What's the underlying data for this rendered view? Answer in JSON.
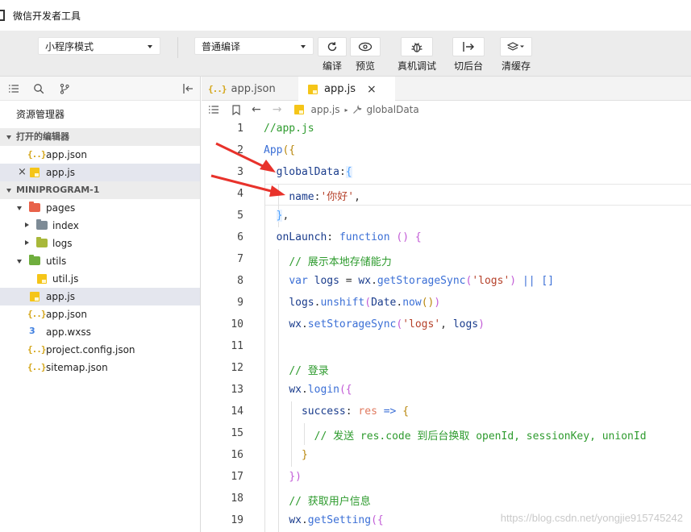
{
  "window": {
    "title": "微信开发者工具"
  },
  "toolbar": {
    "mode_select": "小程序模式",
    "compile_select": "普通编译",
    "buttons": [
      {
        "label": "编译",
        "icon": "refresh-icon"
      },
      {
        "label": "预览",
        "icon": "eye-icon"
      },
      {
        "label": "真机调试",
        "icon": "bug-icon"
      },
      {
        "label": "切后台",
        "icon": "switch-background-icon"
      },
      {
        "label": "清缓存",
        "icon": "layers-icon"
      }
    ]
  },
  "sidebar": {
    "title": "资源管理器",
    "open_editors_header": "打开的编辑器",
    "open_editors": [
      "app.json",
      "app.js"
    ],
    "project_header": "MINIPROGRAM-1",
    "tree": [
      {
        "label": "pages",
        "type": "folder"
      },
      {
        "label": "index",
        "type": "folder"
      },
      {
        "label": "logs",
        "type": "folder"
      },
      {
        "label": "utils",
        "type": "folder"
      },
      {
        "label": "util.js",
        "type": "js"
      },
      {
        "label": "app.js",
        "type": "js"
      },
      {
        "label": "app.json",
        "type": "json"
      },
      {
        "label": "app.wxss",
        "type": "wxss"
      },
      {
        "label": "project.config.json",
        "type": "json"
      },
      {
        "label": "sitemap.json",
        "type": "json"
      }
    ]
  },
  "editor": {
    "tabs": [
      "app.json",
      "app.js"
    ],
    "breadcrumb": {
      "file": "app.js",
      "symbol": "globalData"
    },
    "line_numbers": [
      "1",
      "2",
      "3",
      "4",
      "5",
      "6",
      "7",
      "8",
      "9",
      "10",
      "11",
      "12",
      "13",
      "14",
      "15",
      "16",
      "17",
      "18",
      "19"
    ]
  },
  "watermark": "https://blog.csdn.net/yongjie915745242",
  "colors": {
    "arrow": "#e8322b",
    "keyword": "#3b6fd6",
    "comment": "#2e9b2e",
    "string": "#b5412a"
  }
}
